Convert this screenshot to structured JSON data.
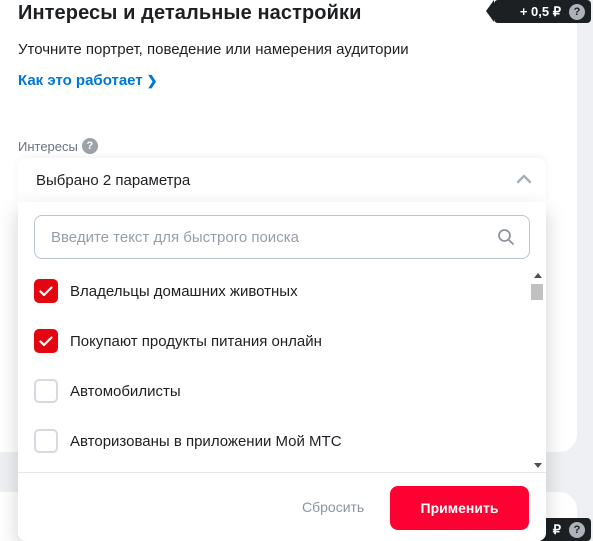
{
  "card": {
    "title": "Интересы и детальные настройки",
    "subtitle": "Уточните портрет, поведение или намерения аудитории",
    "how_link": "Как это работает",
    "price_badge_top": "+ 0,5 ₽",
    "price_badge_bottom": "₽"
  },
  "interests": {
    "label": "Интересы",
    "selected_text": "Выбрано 2 параметра",
    "search_placeholder": "Введите текст для быстрого поиска",
    "search_value": "",
    "items": [
      {
        "label": "Владельцы домашних животных",
        "checked": true
      },
      {
        "label": "Покупают продукты питания онлайн",
        "checked": true
      },
      {
        "label": "Автомобилисты",
        "checked": false
      },
      {
        "label": "Авторизованы в приложении Мой МТС",
        "checked": false
      }
    ],
    "reset_label": "Сбросить",
    "apply_label": "Применить"
  },
  "icons": {
    "help": "question-icon",
    "chevron_right": "chevron-right-icon",
    "chevron_up": "chevron-up-icon",
    "search": "search-icon",
    "check": "check-icon"
  },
  "colors": {
    "accent_red": "#ff0032",
    "checkbox_red": "#e30611",
    "link_blue": "#0077d6",
    "badge_dark": "#1d2023"
  }
}
